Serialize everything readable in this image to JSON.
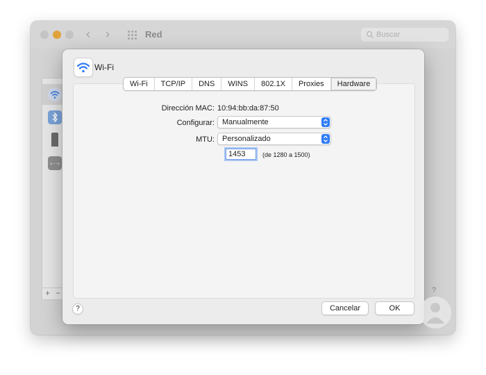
{
  "background_window": {
    "title": "Red",
    "search_placeholder": "Buscar",
    "sidebar_controls": [
      "+",
      "−"
    ],
    "help": "?"
  },
  "sheet": {
    "title": "Wi-Fi",
    "tabs": [
      {
        "label": "Wi-Fi",
        "active": false
      },
      {
        "label": "TCP/IP",
        "active": false
      },
      {
        "label": "DNS",
        "active": false
      },
      {
        "label": "WINS",
        "active": false
      },
      {
        "label": "802.1X",
        "active": false
      },
      {
        "label": "Proxies",
        "active": false
      },
      {
        "label": "Hardware",
        "active": true
      }
    ],
    "hardware": {
      "mac_label": "Dirección MAC:",
      "mac_value": "10:94:bb:da:87:50",
      "configure_label": "Configurar:",
      "configure_value": "Manualmente",
      "mtu_label": "MTU:",
      "mtu_value": "Personalizado",
      "mtu_custom": "1453",
      "mtu_range": "(de 1280 a 1500)"
    },
    "help": "?",
    "cancel_label": "Cancelar",
    "ok_label": "OK"
  },
  "colors": {
    "accent": "#2f7cf6",
    "traffic_light_minimize": "#e0a23a"
  },
  "icons": [
    "wifi-icon",
    "bluetooth-icon",
    "device-icon",
    "ethernet-icon",
    "search-icon",
    "grid-icon",
    "updown-chevron-icon",
    "logo-watermark"
  ]
}
